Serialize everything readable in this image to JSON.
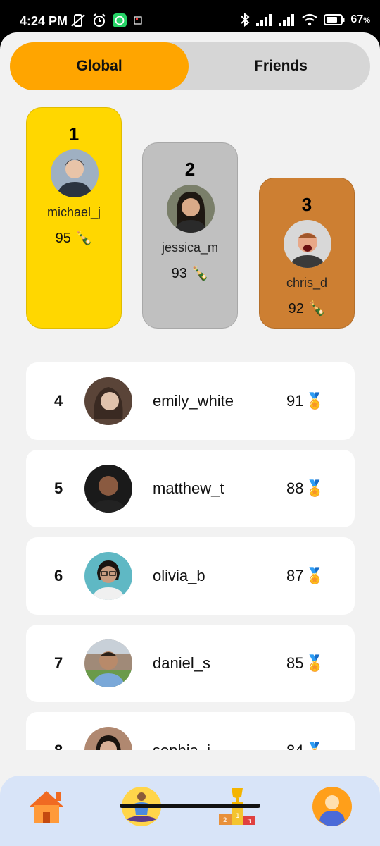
{
  "status_bar": {
    "time": "4:24 PM",
    "battery": "67"
  },
  "tabs": [
    {
      "label": "Global",
      "active": true
    },
    {
      "label": "Friends",
      "active": false
    }
  ],
  "podium": [
    {
      "rank": "1",
      "username": "michael_j",
      "score": "95",
      "color": "#ffd700"
    },
    {
      "rank": "2",
      "username": "jessica_m",
      "score": "93",
      "color": "#c0c0c0"
    },
    {
      "rank": "3",
      "username": "chris_d",
      "score": "92",
      "color": "#cd7f32"
    }
  ],
  "leaderboard": [
    {
      "rank": "4",
      "username": "emily_white",
      "score": "91"
    },
    {
      "rank": "5",
      "username": "matthew_t",
      "score": "88"
    },
    {
      "rank": "6",
      "username": "olivia_b",
      "score": "87"
    },
    {
      "rank": "7",
      "username": "daniel_s",
      "score": "85"
    },
    {
      "rank": "8",
      "username": "sophia_j",
      "score": "84"
    }
  ],
  "bottom_nav": [
    {
      "icon": "home-icon"
    },
    {
      "icon": "meditation-icon"
    },
    {
      "icon": "leaderboard-podium-icon"
    },
    {
      "icon": "profile-icon"
    }
  ],
  "colors": {
    "accent": "#ffa500",
    "background": "#f2f2f2",
    "nav_background": "#d8e4f8"
  }
}
